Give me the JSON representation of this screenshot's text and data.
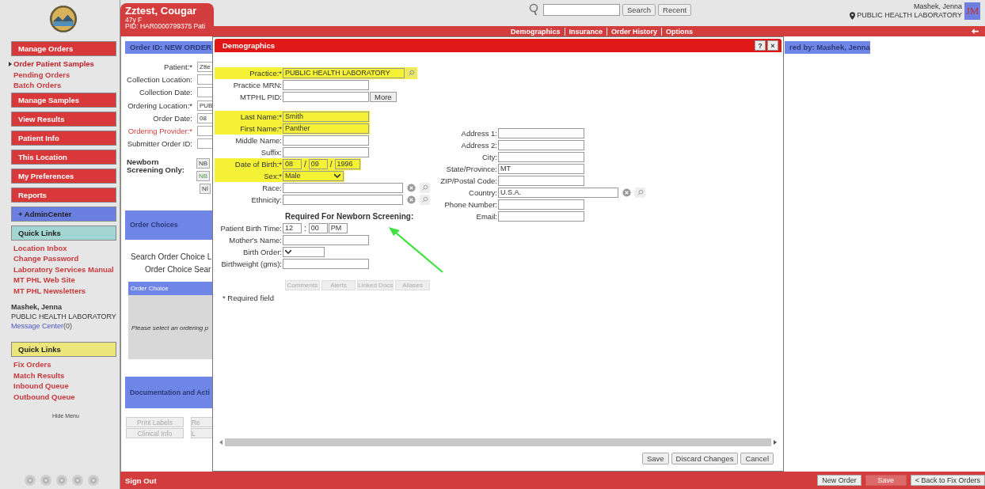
{
  "sidebar": {
    "top_items": [
      {
        "kind": "section",
        "label": "Manage Orders",
        "color": "#d9383a"
      },
      {
        "kind": "link",
        "label": "Order Patient Samples",
        "selected": true
      },
      {
        "kind": "link",
        "label": "Pending Orders",
        "selected": false
      },
      {
        "kind": "link",
        "label": "Batch Orders",
        "selected": false
      },
      {
        "kind": "section",
        "label": "Manage Samples",
        "color": "#d9383a"
      },
      {
        "kind": "section",
        "label": "View Results",
        "color": "#d9383a"
      },
      {
        "kind": "section",
        "label": "Patient Info",
        "color": "#d9383a"
      },
      {
        "kind": "section",
        "label": "This Location",
        "color": "#d9383a"
      },
      {
        "kind": "section",
        "label": "My Preferences",
        "color": "#d9383a"
      },
      {
        "kind": "section",
        "label": "Reports",
        "color": "#d9383a"
      },
      {
        "kind": "section",
        "label": "+ AdminCenter",
        "color": "#6b7fe0"
      },
      {
        "kind": "section",
        "label": "Quick Links",
        "color": "#a3d6d2"
      },
      {
        "kind": "link",
        "label": "Location Inbox",
        "selected": false
      },
      {
        "kind": "link",
        "label": "Change Password",
        "selected": false
      },
      {
        "kind": "link",
        "label": "Laboratory Services Manual",
        "selected": false
      },
      {
        "kind": "link",
        "label": "MT PHL Web Site",
        "selected": false
      },
      {
        "kind": "link",
        "label": "MT PHL Newsletters",
        "selected": false
      }
    ],
    "user": {
      "name": "Mashek, Jenna",
      "location": "PUBLIC HEALTH LABORATORY",
      "message_link": "Message Center",
      "message_count": "(0)"
    },
    "bottom_items": [
      {
        "kind": "section",
        "label": "Quick Links",
        "color": "#ebe57a"
      },
      {
        "kind": "link",
        "label": "Fix Orders",
        "selected": false
      },
      {
        "kind": "link",
        "label": "Match Results",
        "selected": false
      },
      {
        "kind": "link",
        "label": "Inbound Queue",
        "selected": false
      },
      {
        "kind": "link",
        "label": "Outbound Queue",
        "selected": false
      }
    ],
    "hide_menu": "Hide Menu"
  },
  "header": {
    "patient": {
      "name": "Zztest, Cougar",
      "age_sex": "47y F",
      "pid": "PID: HAR0000799375  Pati"
    },
    "search": {
      "button": "Search",
      "recent": "Recent"
    },
    "user": {
      "name": "Mashek, Jenna",
      "location": "PUBLIC HEALTH LABORATORY",
      "initials": "JM"
    },
    "tabs": [
      "Demographics",
      "Insurance",
      "Order History",
      "Options"
    ]
  },
  "order": {
    "id_bar": "Order ID:  NEW ORDER",
    "by_bar": "red by: Mashek, Jenna",
    "fields": [
      {
        "label": "Patient:*",
        "value": "Ztte",
        "invalid": false
      },
      {
        "label": "Collection Location:",
        "invalid": false
      },
      {
        "label": "Collection Date:",
        "invalid": false
      },
      {
        "label": "Ordering Location:*",
        "value": "PUB",
        "invalid": false
      },
      {
        "label": "Order Date:",
        "value": "08",
        "invalid": false
      },
      {
        "label": "Ordering Provider:*",
        "invalid": true
      },
      {
        "label": "Submitter Order ID:",
        "invalid": false
      }
    ],
    "newborn_label": "Newborn Screening Only:",
    "newborn_buttons": [
      {
        "label": "NB",
        "selected": false
      },
      {
        "label": "NB",
        "selected": true
      },
      {
        "label": "NI",
        "selected": false
      }
    ],
    "choices_panel": "Order Choices",
    "search_lines": [
      "Search Order Choice L",
      "Order Choice Sear"
    ],
    "choice_table": {
      "header": "Order Choice",
      "empty": "Please select an ordering p"
    },
    "documentation_panel": "Documentation and Acti",
    "buttons": [
      [
        "Print Labels",
        "Re"
      ],
      [
        "Clinical Info",
        "L"
      ]
    ]
  },
  "dialog": {
    "title": "Demographics",
    "help": "?",
    "close": "×",
    "left_fields": [
      {
        "kind": "lookup",
        "label": "Practice:*",
        "value": "PUBLIC HEALTH LABORATORY",
        "highlighted": true
      },
      {
        "kind": "text",
        "label": "Practice MRN:",
        "highlighted": false
      },
      {
        "kind": "text_button",
        "label": "MTPHL PID:",
        "button": "More",
        "highlighted": false
      },
      {
        "kind": "gap"
      },
      {
        "kind": "text",
        "label": "Last Name:*",
        "value": "Smith",
        "highlighted": true
      },
      {
        "kind": "text",
        "label": "First Name:*",
        "value": "Panther",
        "highlighted": true
      },
      {
        "kind": "text",
        "label": "Middle Name:",
        "highlighted": false
      },
      {
        "kind": "text",
        "label": "Suffix:",
        "highlighted": false
      },
      {
        "kind": "date",
        "label": "Date of Birth:*",
        "parts": [
          "08",
          "09",
          "1996"
        ],
        "separator": "/",
        "highlighted": true
      },
      {
        "kind": "select",
        "label": "Sex:*",
        "value": "Male",
        "highlighted": true
      },
      {
        "kind": "lookup_clear",
        "label": "Race:",
        "highlighted": false
      },
      {
        "kind": "lookup_clear",
        "label": "Ethnicity:",
        "highlighted": false
      },
      {
        "kind": "heading",
        "label": "Required For Newborn Screening:"
      },
      {
        "kind": "time",
        "label": "Patient Birth Time:",
        "parts": [
          "12",
          "00",
          "PM"
        ],
        "separator": ":",
        "highlighted": false
      },
      {
        "kind": "text",
        "label": "Mother's Name:",
        "highlighted": false
      },
      {
        "kind": "select",
        "label": "Birth Order:",
        "highlighted": false
      },
      {
        "kind": "text",
        "label": "Birthweight (gms):",
        "highlighted": false
      }
    ],
    "right_fields": [
      {
        "kind": "text",
        "label": "Address 1:"
      },
      {
        "kind": "text",
        "label": "Address 2:"
      },
      {
        "kind": "text",
        "label": "City:"
      },
      {
        "kind": "text",
        "label": "State/Province:",
        "value": "MT"
      },
      {
        "kind": "text",
        "label": "ZIP/Postal Code:"
      },
      {
        "kind": "lookup_clear",
        "label": "Country:",
        "value": "U.S.A."
      },
      {
        "kind": "text",
        "label": "Phone Number:"
      },
      {
        "kind": "text",
        "label": "Email:"
      }
    ],
    "sub_tabs": [
      "Comments",
      "Alerts",
      "Linked Docs",
      "Aliases"
    ],
    "required_note": "* Required field",
    "footer_buttons": [
      "Save",
      "Discard Changes",
      "Cancel"
    ]
  },
  "bottom_bar": {
    "sign_out": "Sign Out",
    "buttons": [
      {
        "label": "New Order",
        "disabled": false
      },
      {
        "label": "Save",
        "disabled": true
      },
      {
        "label": "< Back to Fix Orders",
        "disabled": false
      }
    ]
  }
}
